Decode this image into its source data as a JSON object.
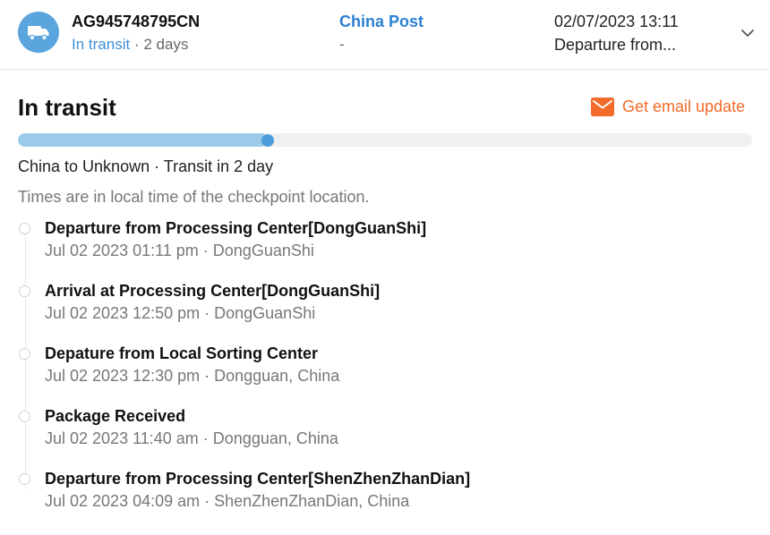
{
  "shipment": {
    "tracking_number": "AG945748795CN",
    "status": "In transit",
    "separator": " · ",
    "duration": "2 days",
    "carrier": "China Post",
    "carrier_sub": "-",
    "latest_time": "02/07/2023 13:11",
    "latest_event": "Departure from..."
  },
  "status_section": {
    "title": "In transit",
    "email_update_label": "Get email update",
    "progress_fraction": 0.34,
    "route": "China to Unknown · Transit in 2 day",
    "times_note": "Times are in local time of the checkpoint location."
  },
  "timeline": [
    {
      "event": "Departure from Processing Center[DongGuanShi]",
      "meta": "Jul 02 2023 01:11 pm · DongGuanShi"
    },
    {
      "event": "Arrival at Processing Center[DongGuanShi]",
      "meta": "Jul 02 2023 12:50 pm · DongGuanShi"
    },
    {
      "event": "Depature from Local Sorting Center",
      "meta": "Jul 02 2023 12:30 pm · Dongguan, China"
    },
    {
      "event": "Package Received",
      "meta": "Jul 02 2023 11:40 am · Dongguan, China"
    },
    {
      "event": "Departure from Processing Center[ShenZhenZhanDian]",
      "meta": "Jul 02 2023 04:09 am · ShenZhenZhanDian, China"
    }
  ],
  "icons": {
    "truck": "truck-icon",
    "chevron": "chevron-down-icon",
    "email": "envelope-icon"
  },
  "colors": {
    "accent_blue": "#5aa5de",
    "link_blue": "#3d8fd6",
    "carrier_blue": "#2c7fd2",
    "email_orange": "#f26b2a",
    "progress_fill": "#9ccbea",
    "progress_knob": "#4b9ddd"
  }
}
